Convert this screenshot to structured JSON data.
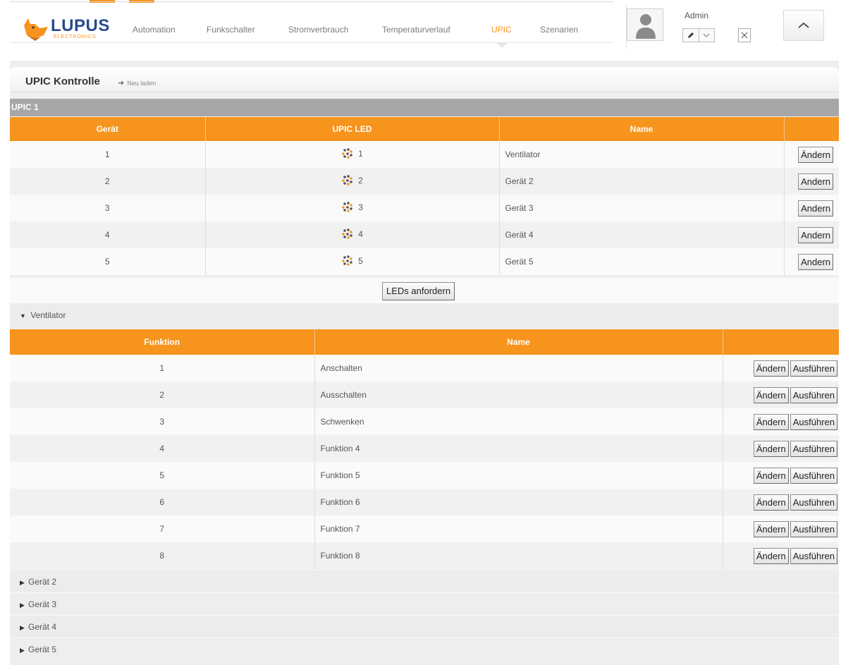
{
  "header": {
    "logo_text": "LUPUS",
    "logo_sub": "ELECTRONICS",
    "nav": [
      {
        "label": "Automation",
        "active": false
      },
      {
        "label": "Funkschalter",
        "active": false
      },
      {
        "label": "Stromverbrauch",
        "active": false
      },
      {
        "label": "Temperaturverlauf",
        "active": false
      },
      {
        "label": "UPIC",
        "active": true
      },
      {
        "label": "Szenarien",
        "active": false
      }
    ],
    "user": {
      "name": "Admin"
    },
    "icons": {
      "avatar": "user-avatar-icon",
      "edit": "pencil-icon",
      "dropdown": "chevron-down-icon",
      "close": "close-icon",
      "collapse": "chevron-up-icon"
    }
  },
  "page": {
    "title": "UPIC Kontrolle",
    "reload_label": "Neu laden"
  },
  "upic": {
    "section_title": "UPIC 1",
    "headers": {
      "device": "Gerät",
      "led": "UPIC LED",
      "name": "Name"
    },
    "rows": [
      {
        "device": "1",
        "led": "1",
        "name": "Ventilator",
        "edit": "Ändern"
      },
      {
        "device": "2",
        "led": "2",
        "name": "Gerät 2",
        "edit": "Andern"
      },
      {
        "device": "3",
        "led": "3",
        "name": "Gerät 3",
        "edit": "Andern"
      },
      {
        "device": "4",
        "led": "4",
        "name": "Gerät 4",
        "edit": "Andern"
      },
      {
        "device": "5",
        "led": "5",
        "name": "Gerät 5",
        "edit": "Andern"
      }
    ],
    "request_leds": "LEDs anfordern"
  },
  "device_detail": {
    "title": "Ventilator",
    "headers": {
      "function": "Funktion",
      "name": "Name"
    },
    "rows": [
      {
        "function": "1",
        "name": "Anschalten",
        "edit": "Ändern",
        "run": "Ausführen"
      },
      {
        "function": "2",
        "name": "Ausschalten",
        "edit": "Ändern",
        "run": "Ausführen"
      },
      {
        "function": "3",
        "name": "Schwenken",
        "edit": "Ändern",
        "run": "Ausführen"
      },
      {
        "function": "4",
        "name": "Funktion 4",
        "edit": "Ändern",
        "run": "Ausführen"
      },
      {
        "function": "5",
        "name": "Funktion 5",
        "edit": "Ändern",
        "run": "Ausführen"
      },
      {
        "function": "6",
        "name": "Funktion 6",
        "edit": "Ändern",
        "run": "Ausführen"
      },
      {
        "function": "7",
        "name": "Funktion 7",
        "edit": "Ändern",
        "run": "Ausführen"
      },
      {
        "function": "8",
        "name": "Funktion 8",
        "edit": "Ändern",
        "run": "Ausführen"
      }
    ]
  },
  "collapsed_groups": [
    "Gerät 2",
    "Gerät 3",
    "Gerät 4",
    "Gerät 5"
  ],
  "colors": {
    "accent": "#f7941d",
    "brand": "#2b4a8e",
    "section_bar": "#a7a7a7"
  }
}
